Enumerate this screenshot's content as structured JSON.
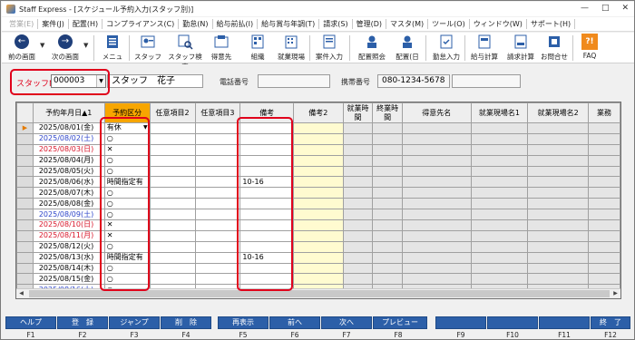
{
  "window": {
    "title": "Staff Express - [スケジュール予約入力(スタッフ別)]",
    "controls": [
      "—",
      "□",
      "✕"
    ]
  },
  "menu": [
    {
      "label": "営業(E)",
      "disabled": true
    },
    {
      "label": "案件(J)",
      "disabled": false
    },
    {
      "label": "配置(H)",
      "disabled": false
    },
    {
      "label": "コンプライアンス(C)",
      "disabled": false
    },
    {
      "label": "勤怠(N)",
      "disabled": false
    },
    {
      "label": "給与前払(I)",
      "disabled": false
    },
    {
      "label": "給与賞与年調(T)",
      "disabled": false
    },
    {
      "label": "請求(S)",
      "disabled": false
    },
    {
      "label": "管理(D)",
      "disabled": false
    },
    {
      "label": "マスタ(M)",
      "disabled": false
    },
    {
      "label": "ツール(O)",
      "disabled": false
    },
    {
      "label": "ウィンドウ(W)",
      "disabled": false
    },
    {
      "label": "サポート(H)",
      "disabled": false
    }
  ],
  "toolbar": {
    "prev": "前の画面",
    "next": "次の画面",
    "menu": "メニュー",
    "staff": "スタッフ",
    "staff_search": "スタッフ検索",
    "client": "得意先",
    "org": "組織",
    "site": "就業現場",
    "case_entry": "案件入力",
    "placement_query": "配置照会",
    "placement_day": "配置(日",
    "attendance": "勤怠入力",
    "payroll": "給与計算",
    "billing": "請求計算",
    "contact": "お問合せ",
    "faq": "FAQ",
    "faq_icon_text": "?!"
  },
  "staff_bar": {
    "staff_no_label": "スタッフNO",
    "staff_no_value": "000003",
    "staff_name": "スタッフ　花子",
    "phone_label": "電話番号",
    "phone_value": "",
    "mobile_label": "携帯番号",
    "mobile_value": "080-1234-5678",
    "extra_value": ""
  },
  "grid": {
    "columns": [
      "予約年月日▲1",
      "予約区分",
      "任意項目2",
      "任意項目3",
      "備考",
      "備考2",
      "就業時間",
      "終業時間",
      "得意先名",
      "就業現場名1",
      "就業現場名2",
      "業務"
    ],
    "current_row_marker": "▶",
    "rows": [
      {
        "date": "2025/08/01(金)",
        "wk": "",
        "kubun": "有休",
        "note": ""
      },
      {
        "date": "2025/08/02(土)",
        "wk": "sat",
        "kubun": "○",
        "note": ""
      },
      {
        "date": "2025/08/03(日)",
        "wk": "sun",
        "kubun": "✕",
        "note": ""
      },
      {
        "date": "2025/08/04(月)",
        "wk": "",
        "kubun": "○",
        "note": ""
      },
      {
        "date": "2025/08/05(火)",
        "wk": "",
        "kubun": "○",
        "note": ""
      },
      {
        "date": "2025/08/06(水)",
        "wk": "",
        "kubun": "時間指定有",
        "note": "10-16"
      },
      {
        "date": "2025/08/07(木)",
        "wk": "",
        "kubun": "○",
        "note": ""
      },
      {
        "date": "2025/08/08(金)",
        "wk": "",
        "kubun": "○",
        "note": ""
      },
      {
        "date": "2025/08/09(土)",
        "wk": "sat",
        "kubun": "○",
        "note": ""
      },
      {
        "date": "2025/08/10(日)",
        "wk": "sun",
        "kubun": "✕",
        "note": ""
      },
      {
        "date": "2025/08/11(月)",
        "wk": "sun",
        "kubun": "✕",
        "note": ""
      },
      {
        "date": "2025/08/12(火)",
        "wk": "",
        "kubun": "○",
        "note": ""
      },
      {
        "date": "2025/08/13(水)",
        "wk": "",
        "kubun": "時間指定有",
        "note": "10-16"
      },
      {
        "date": "2025/08/14(木)",
        "wk": "",
        "kubun": "○",
        "note": ""
      },
      {
        "date": "2025/08/15(金)",
        "wk": "",
        "kubun": "○",
        "note": ""
      },
      {
        "date": "2025/08/16(土)",
        "wk": "sat",
        "kubun": "○",
        "note": ""
      }
    ]
  },
  "fkeys": [
    {
      "label": "ヘルプ",
      "key": "F1"
    },
    {
      "label": "登　録",
      "key": "F2"
    },
    {
      "label": "ジャンプ",
      "key": "F3"
    },
    {
      "label": "削　除",
      "key": "F4"
    },
    {
      "label": "再表示",
      "key": "F5"
    },
    {
      "label": "前へ",
      "key": "F6"
    },
    {
      "label": "次へ",
      "key": "F7"
    },
    {
      "label": "プレビュー",
      "key": "F8"
    },
    {
      "label": "",
      "key": "F9"
    },
    {
      "label": "",
      "key": "F10"
    },
    {
      "label": "",
      "key": "F11"
    },
    {
      "label": "終　了",
      "key": "F12"
    }
  ],
  "colors": {
    "highlight_red": "#e0001b",
    "fkey_blue": "#2c5fa8",
    "selected_header": "#f7a600",
    "editable_cell": "#fffbd0",
    "saturday": "#2d44c9",
    "sunday": "#d8162a"
  }
}
